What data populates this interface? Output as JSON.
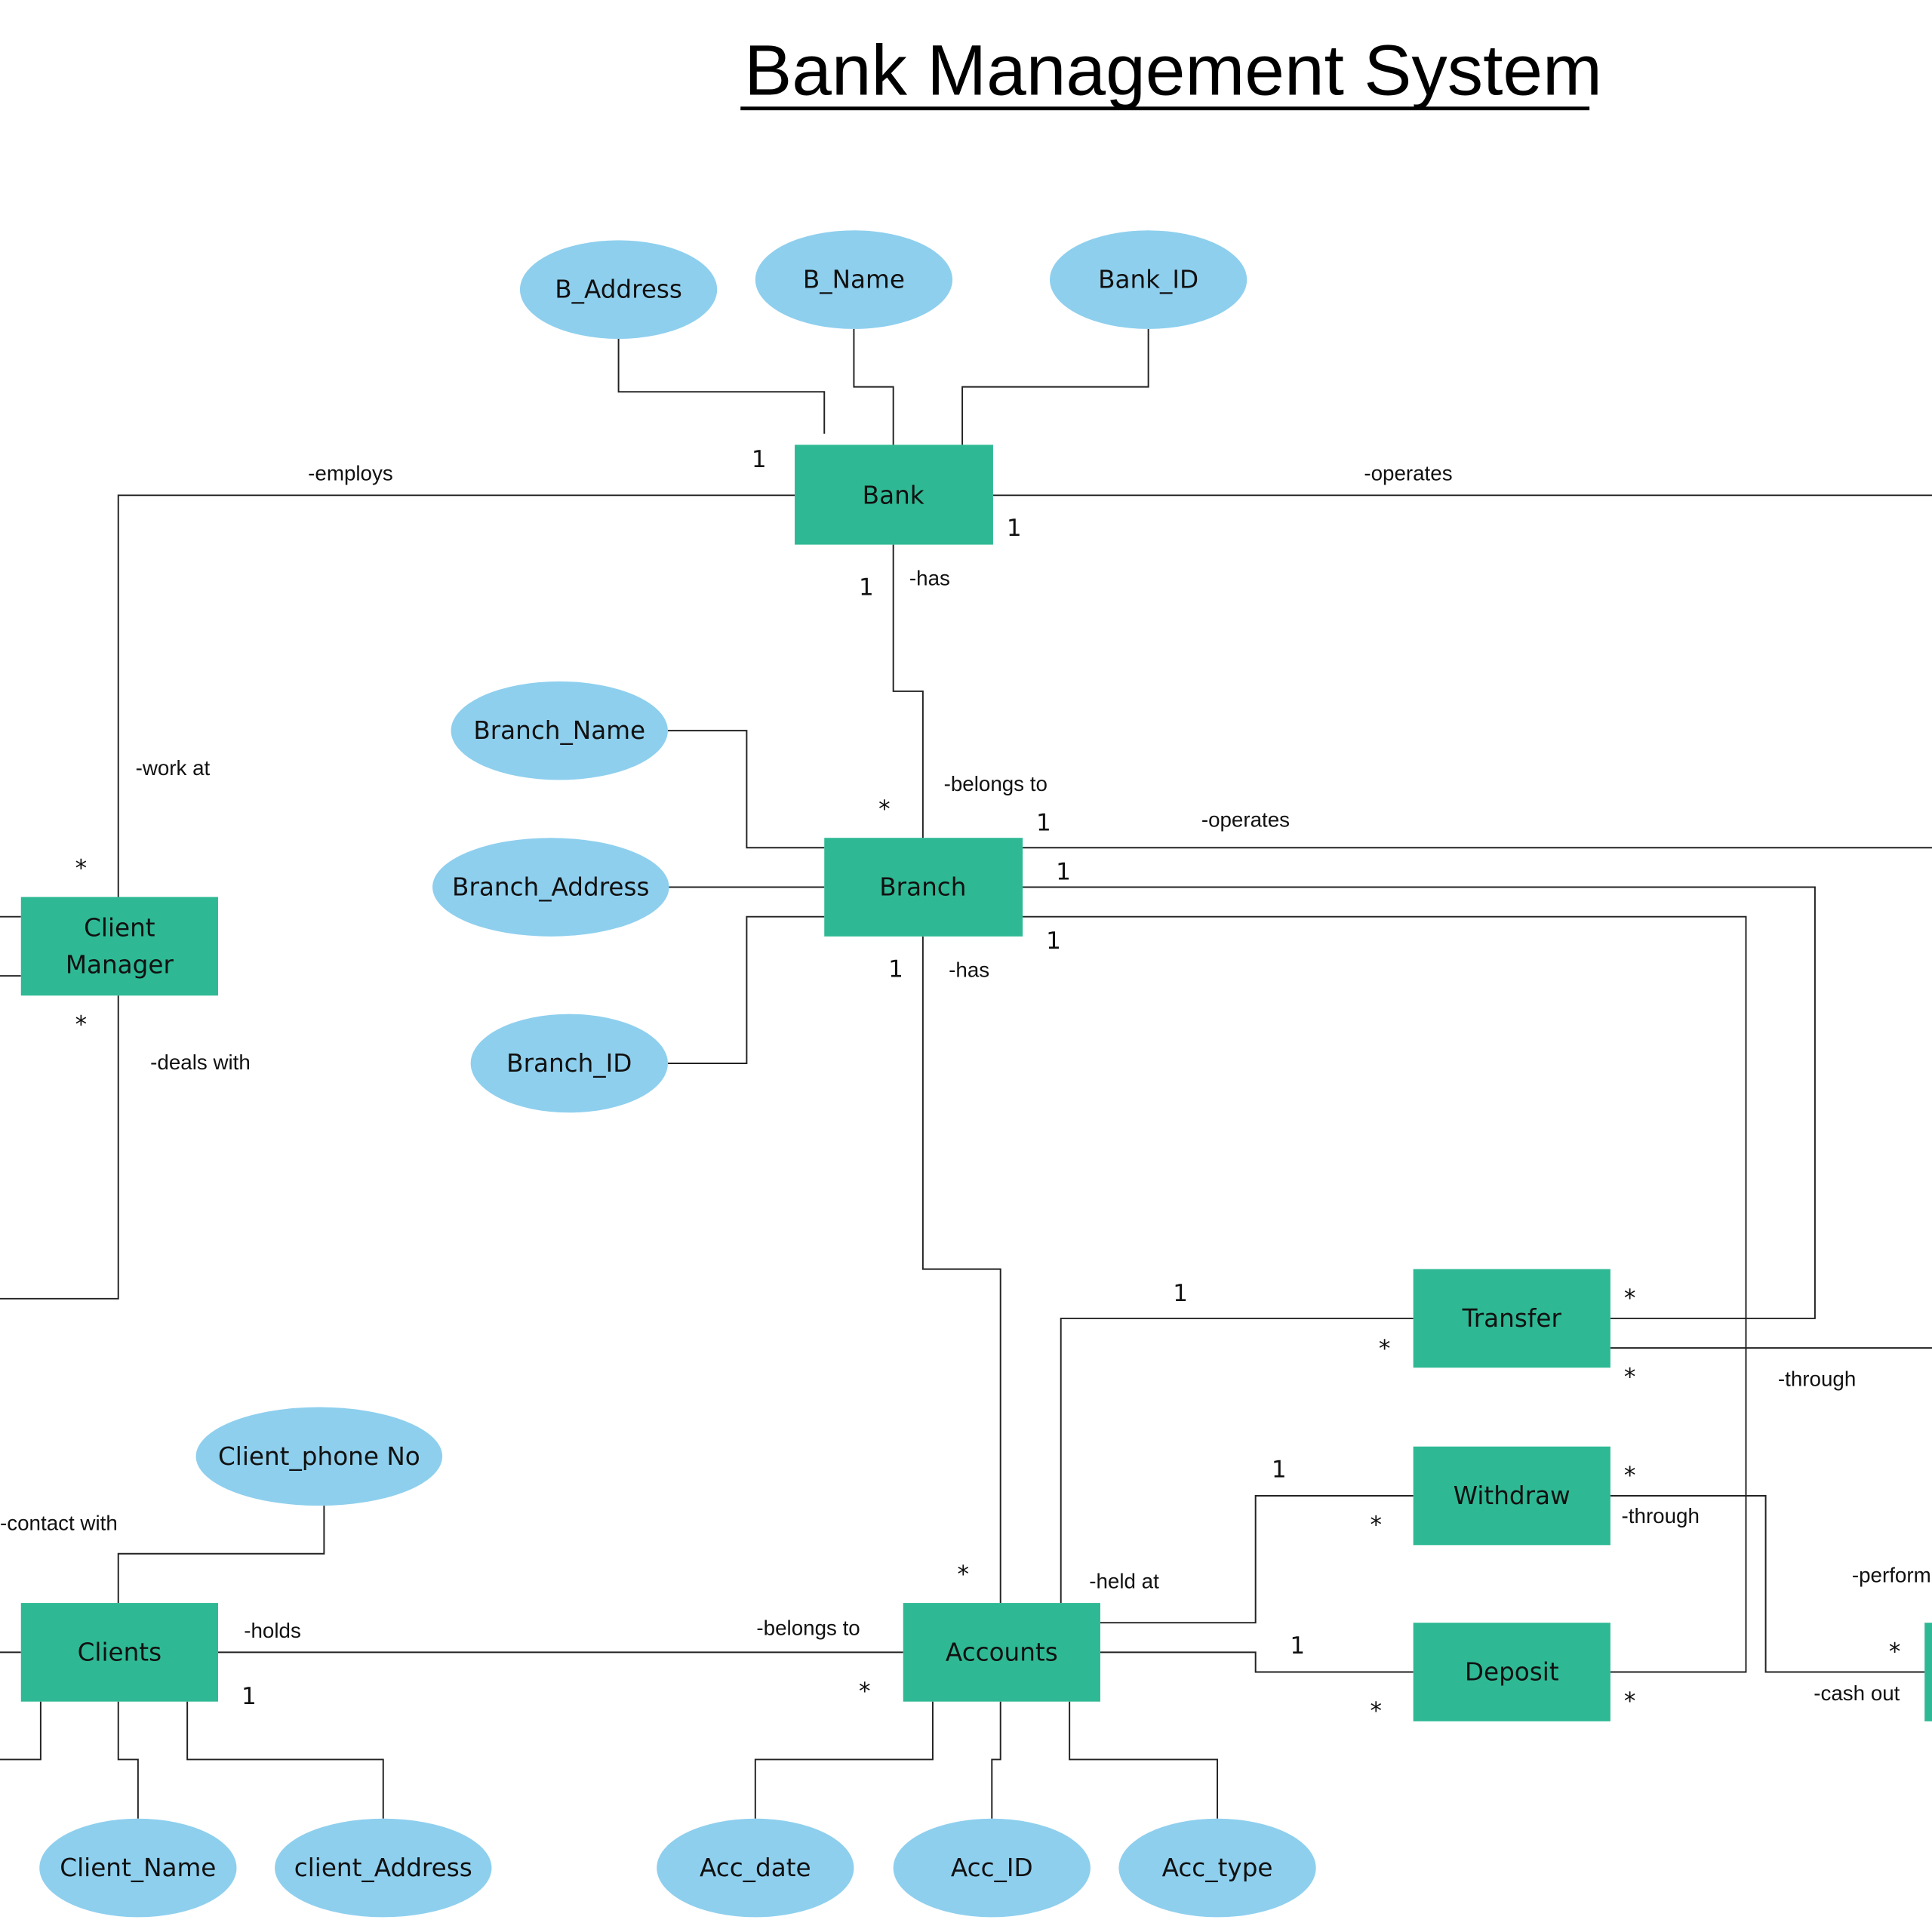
{
  "title": "Bank Management System",
  "colors": {
    "entity_fill": "#2eb994",
    "attribute_fill": "#8ecfee",
    "line": "#222222"
  },
  "entities": {
    "bank": "Bank",
    "branch": "Branch",
    "client_manager_line1": "Client",
    "client_manager_line2": "Manager",
    "clients": "Clients",
    "accounts": "Accounts",
    "transfer": "Transfer",
    "withdraw": "Withdraw",
    "deposit": "Deposit"
  },
  "attributes": {
    "b_address": "B_Address",
    "b_name": "B_Name",
    "bank_id": "Bank_ID",
    "branch_name": "Branch_Name",
    "branch_address": "Branch_Address",
    "branch_id": "Branch_ID",
    "client_phone": "Client_phone No",
    "client_name": "Client_Name",
    "client_address": "client_Address",
    "acc_date": "Acc_date",
    "acc_id": "Acc_ID",
    "acc_type": "Acc_type"
  },
  "relationships": {
    "employs": "-employs",
    "operates_bank": "-operates",
    "has_bank": "-has",
    "work_at": "-work at",
    "belongs_to_branch": "-belongs to",
    "operates_branch": "-operates",
    "deals_with": "-deals with",
    "has_branch": "-has",
    "through_transfer": "-through",
    "through_withdraw": "-through",
    "contact_with": "-contact  with",
    "holds": "-holds",
    "belongs_to_accounts": "-belongs to",
    "held_at": "-held at",
    "perform": "-perform",
    "cash_out": "-cash out"
  },
  "multiplicities": {
    "bank_left": "1",
    "bank_right": "1",
    "bank_bottom": "1",
    "branch_top": "*",
    "branch_top_right": "1",
    "branch_right_mid": "1",
    "branch_right_low": "1",
    "branch_bottom": "1",
    "manager_top": "*",
    "manager_bottom": "*",
    "transfer_in_one": "1",
    "transfer_left": "*",
    "transfer_right_top": "*",
    "transfer_right_bottom": "*",
    "withdraw_in_one": "1",
    "withdraw_left": "*",
    "withdraw_right": "*",
    "deposit_in_one": "1",
    "deposit_left": "*",
    "deposit_right": "*",
    "accounts_top": "*",
    "accounts_left": "*",
    "clients_right": "1",
    "atm_left": "*"
  }
}
